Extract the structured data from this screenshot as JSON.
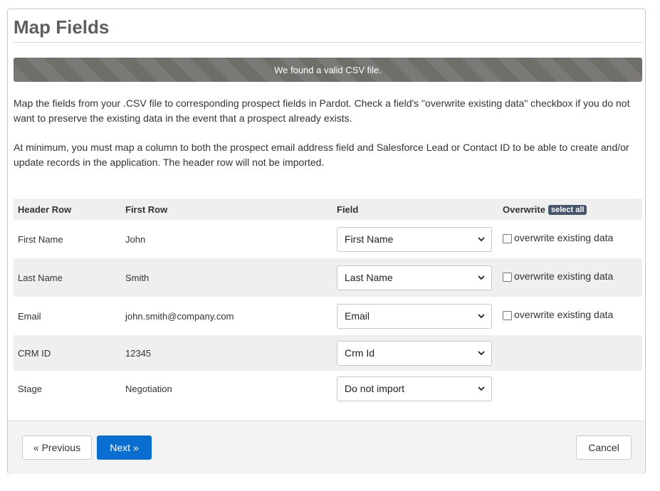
{
  "page": {
    "title": "Map Fields",
    "alert": "We found a valid CSV file.",
    "intro": "Map the fields from your .CSV file to corresponding prospect fields in Pardot. Check a field's \"overwrite existing data\" checkbox if you do not want to preserve the existing data in the event that a prospect already exists.",
    "requirement": "At minimum, you must map a column to both the prospect email address field and Salesforce Lead or Contact ID to be able to create and/or update records in the application. The header row will not be imported."
  },
  "table": {
    "headers": {
      "header_row": "Header Row",
      "first_row": "First Row",
      "field": "Field",
      "overwrite": "Overwrite",
      "select_all": "select all"
    },
    "overwrite_label": "overwrite existing data",
    "rows": [
      {
        "header": "First Name",
        "first": "John",
        "field": "First Name",
        "overwrite": "overwrite existing data"
      },
      {
        "header": "Last Name",
        "first": "Smith",
        "field": "Last Name",
        "overwrite": "overwrite existing data"
      },
      {
        "header": "Email",
        "first": "john.smith@company.com",
        "field": "Email",
        "overwrite": "overwrite existing data"
      },
      {
        "header": "CRM ID",
        "first": "12345",
        "field": "Crm Id"
      },
      {
        "header": "Stage",
        "first": "Negotiation",
        "field": "Do not import"
      }
    ]
  },
  "footer": {
    "previous": "« Previous",
    "next": "Next »",
    "cancel": "Cancel"
  },
  "colors": {
    "alert_bg": "#6f6e69",
    "primary": "#0a6ed1",
    "badge_bg": "#45556a"
  },
  "icons": {
    "select_arrow": "chevron-down-icon",
    "checkbox": "checkbox-unchecked"
  }
}
